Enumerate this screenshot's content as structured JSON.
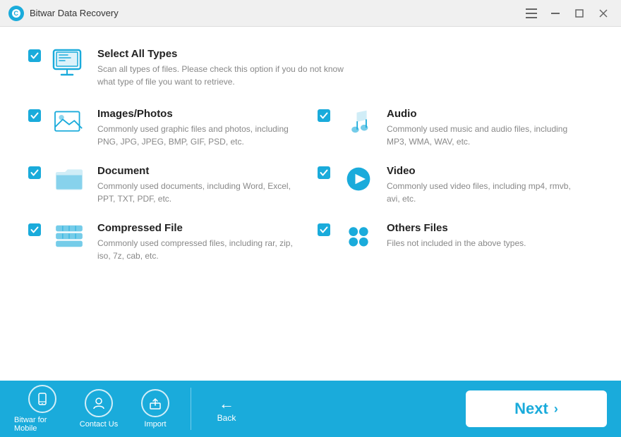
{
  "titlebar": {
    "title": "Bitwar Data Recovery",
    "minimize": "—",
    "maximize": "□",
    "close": "✕",
    "hamburger": "≡"
  },
  "selectAll": {
    "label": "Select All Types",
    "description": "Scan all types of files. Please check this option if you do not know what type of file you want to retrieve."
  },
  "fileTypes": [
    {
      "id": "images",
      "label": "Images/Photos",
      "description": "Commonly used graphic files and photos, including PNG, JPG, JPEG, BMP, GIF, PSD, etc.",
      "checked": true
    },
    {
      "id": "audio",
      "label": "Audio",
      "description": "Commonly used music and audio files, including MP3, WMA, WAV, etc.",
      "checked": true
    },
    {
      "id": "document",
      "label": "Document",
      "description": "Commonly used documents, including Word, Excel, PPT, TXT, PDF, etc.",
      "checked": true
    },
    {
      "id": "video",
      "label": "Video",
      "description": "Commonly used video files, including mp4, rmvb, avi, etc.",
      "checked": true
    },
    {
      "id": "compressed",
      "label": "Compressed File",
      "description": "Commonly used compressed files, including rar, zip, iso, 7z, cab, etc.",
      "checked": true
    },
    {
      "id": "others",
      "label": "Others Files",
      "description": "Files not included in the above types.",
      "checked": true
    }
  ],
  "footer": {
    "mobileLabel": "Bitwar for Mobile",
    "contactLabel": "Contact Us",
    "importLabel": "Import",
    "backLabel": "Back",
    "nextLabel": "Next"
  }
}
